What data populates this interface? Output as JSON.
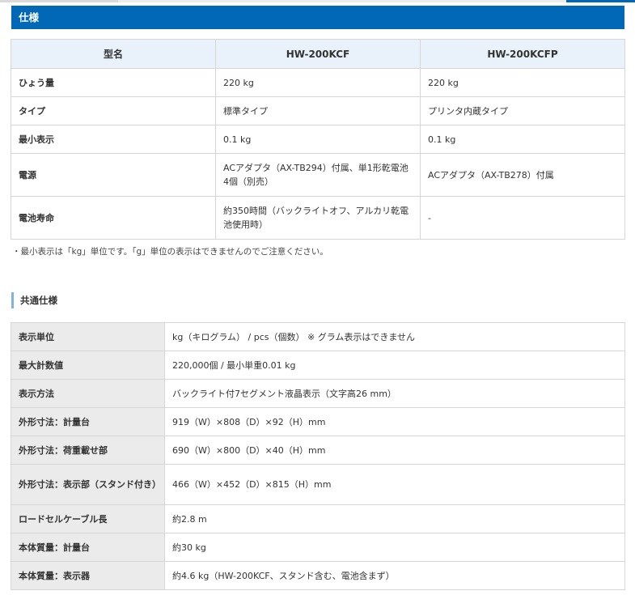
{
  "spec": {
    "title": "仕様",
    "columns": [
      "型名",
      "HW-200KCF",
      "HW-200KCFP"
    ],
    "rows": [
      {
        "label": "ひょう量",
        "v1": "220 kg",
        "v2": "220 kg"
      },
      {
        "label": "タイプ",
        "v1": "標準タイプ",
        "v2": "プリンタ内蔵タイプ"
      },
      {
        "label": "最小表示",
        "v1": "0.1 kg",
        "v2": "0.1 kg"
      },
      {
        "label": "電源",
        "v1": "ACアダプタ（AX-TB294）付属、単1形乾電池4個（別売）",
        "v2": "ACアダプタ（AX-TB278）付属"
      },
      {
        "label": "電池寿命",
        "v1": "約350時間（バックライトオフ、アルカリ乾電池使用時）",
        "v2": "-"
      }
    ],
    "note": "・最小表示は「kg」単位です。「g」単位の表示はできませんのでご注意ください。"
  },
  "common": {
    "title": "共通仕様",
    "rows": [
      {
        "label": "表示単位",
        "value": "kg（キログラム） / pcs（個数） ※ グラム表示はできません"
      },
      {
        "label": "最大計数値",
        "value": "220,000個 / 最小単重0.01 kg"
      },
      {
        "label": "表示方法",
        "value": "バックライト付7セグメント液晶表示（文字高26 mm）"
      },
      {
        "label": "外形寸法：計量台",
        "value": "919（W）×808（D）×92（H）mm"
      },
      {
        "label": "外形寸法：荷重載せ部",
        "value": "690（W）×800（D）×40（H）mm"
      },
      {
        "label": "外形寸法：表示部（スタンド付き）",
        "value": "466（W）×452（D）×815（H）mm"
      },
      {
        "label": "ロードセルケーブル長",
        "value": "約2.8 m"
      },
      {
        "label": "本体質量：計量台",
        "value": "約30 kg"
      },
      {
        "label": "本体質量：表示器",
        "value": "約4.6 kg（HW-200KCF、スタンド含む、電池含まず）"
      }
    ]
  }
}
